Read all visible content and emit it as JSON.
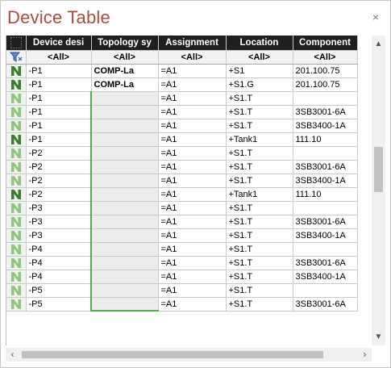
{
  "window": {
    "title": "Device Table",
    "close_glyph": "×"
  },
  "columns": [
    "Device desi",
    "Topology sy",
    "Assignment",
    "Location",
    "Component"
  ],
  "filters": [
    "<All>",
    "<All>",
    "<All>",
    "<All>",
    "<All>"
  ],
  "rows": [
    {
      "icon": "device-dark-icon",
      "device": "-P1",
      "topology": "COMP-La",
      "assignment": "=A1",
      "location": "+S1",
      "component": "201.100.75"
    },
    {
      "icon": "device-dark-icon",
      "device": "-P1",
      "topology": "COMP-La",
      "assignment": "=A1",
      "location": "+S1.G",
      "component": "201.100.75"
    },
    {
      "icon": "device-light-icon",
      "device": "-P1",
      "topology": "",
      "assignment": "=A1",
      "location": "+S1.T",
      "component": ""
    },
    {
      "icon": "device-light-icon",
      "device": "-P1",
      "topology": "",
      "assignment": "=A1",
      "location": "+S1.T",
      "component": "3SB3001-6A"
    },
    {
      "icon": "device-light-icon",
      "device": "-P1",
      "topology": "",
      "assignment": "=A1",
      "location": "+S1.T",
      "component": "3SB3400-1A"
    },
    {
      "icon": "device-dark-icon",
      "device": "-P1",
      "topology": "",
      "assignment": "=A1",
      "location": "+Tank1",
      "component": "111.10"
    },
    {
      "icon": "device-light-icon",
      "device": "-P2",
      "topology": "",
      "assignment": "=A1",
      "location": "+S1.T",
      "component": ""
    },
    {
      "icon": "device-light-icon",
      "device": "-P2",
      "topology": "",
      "assignment": "=A1",
      "location": "+S1.T",
      "component": "3SB3001-6A"
    },
    {
      "icon": "device-light-icon",
      "device": "-P2",
      "topology": "",
      "assignment": "=A1",
      "location": "+S1.T",
      "component": "3SB3400-1A"
    },
    {
      "icon": "device-dark-icon",
      "device": "-P2",
      "topology": "",
      "assignment": "=A1",
      "location": "+Tank1",
      "component": "111.10"
    },
    {
      "icon": "device-light-icon",
      "device": "-P3",
      "topology": "",
      "assignment": "=A1",
      "location": "+S1.T",
      "component": ""
    },
    {
      "icon": "device-light-icon",
      "device": "-P3",
      "topology": "",
      "assignment": "=A1",
      "location": "+S1.T",
      "component": "3SB3001-6A"
    },
    {
      "icon": "device-light-icon",
      "device": "-P3",
      "topology": "",
      "assignment": "=A1",
      "location": "+S1.T",
      "component": "3SB3400-1A"
    },
    {
      "icon": "device-light-icon",
      "device": "-P4",
      "topology": "",
      "assignment": "=A1",
      "location": "+S1.T",
      "component": ""
    },
    {
      "icon": "device-light-icon",
      "device": "-P4",
      "topology": "",
      "assignment": "=A1",
      "location": "+S1.T",
      "component": "3SB3001-6A"
    },
    {
      "icon": "device-light-icon",
      "device": "-P4",
      "topology": "",
      "assignment": "=A1",
      "location": "+S1.T",
      "component": "3SB3400-1A"
    },
    {
      "icon": "device-light-icon",
      "device": "-P5",
      "topology": "",
      "assignment": "=A1",
      "location": "+S1.T",
      "component": ""
    },
    {
      "icon": "device-light-icon",
      "device": "-P5",
      "topology": "",
      "assignment": "=A1",
      "location": "+S1.T",
      "component": "3SB3001-6A"
    }
  ],
  "colors": {
    "title": "#b04a3b",
    "header_bg": "#1f1f1f",
    "highlight": "#4ab043",
    "icon_dark": "#3a7d2c",
    "icon_light": "#8fc47c"
  }
}
